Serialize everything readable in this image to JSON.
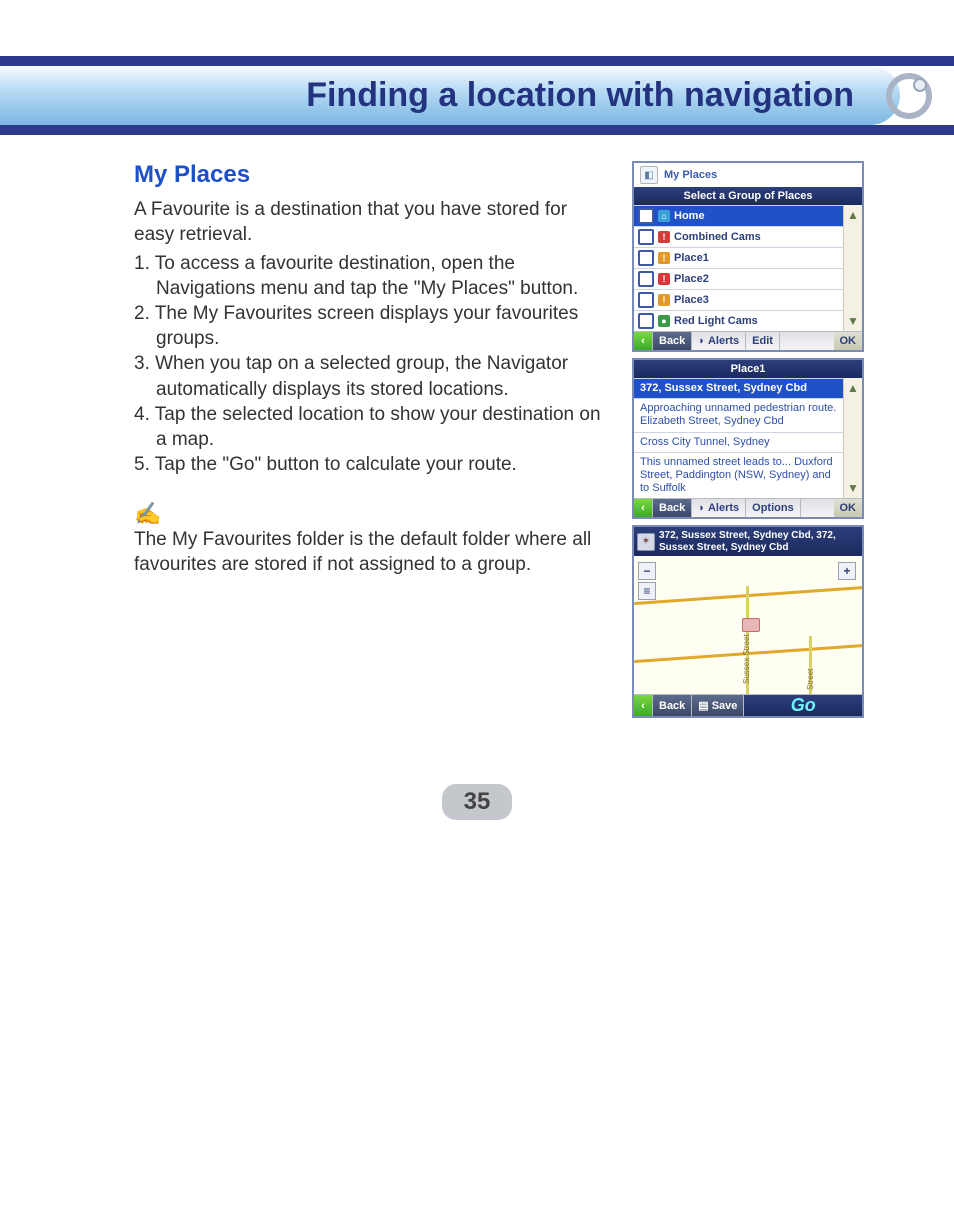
{
  "header": {
    "title": "Finding a location with navigation"
  },
  "section": {
    "heading": "My Places"
  },
  "intro": "A Favourite is a destination that you have stored for easy retrieval.",
  "steps": [
    "1. To access a favourite destination, open the Navigations menu and tap the \"My Places\" button.",
    "2. The My Favourites screen displays your favourites groups.",
    "3. When you tap on a selected group, the Navigator automatically displays its stored locations.",
    "4. Tap the selected location to show your destination on a map.",
    "5. Tap the \"Go\" button to calculate your route."
  ],
  "note": "The My Favourites folder is the default folder where all favourites are stored if not assigned to a group.",
  "shot1": {
    "title": "My Places",
    "bar": "Select a Group of Places",
    "items": [
      {
        "label": "Home",
        "icon": "home",
        "selected": true
      },
      {
        "label": "Combined Cams",
        "icon": "red"
      },
      {
        "label": "Place1",
        "icon": "orange"
      },
      {
        "label": "Place2",
        "icon": "red"
      },
      {
        "label": "Place3",
        "icon": "orange"
      },
      {
        "label": "Red Light Cams",
        "icon": "green"
      }
    ],
    "foot": {
      "back": "Back",
      "alerts": "Alerts",
      "edit": "Edit",
      "ok": "OK"
    }
  },
  "shot2": {
    "bar": "Place1",
    "rows": [
      "372, Sussex Street, Sydney Cbd",
      "Approaching unnamed pedestrian route. Elizabeth Street, Sydney Cbd",
      "Cross City Tunnel, Sydney",
      "This unnamed street leads to... Duxford Street, Paddington (NSW, Sydney) and to Suffolk"
    ],
    "foot": {
      "back": "Back",
      "alerts": "Alerts",
      "options": "Options",
      "ok": "OK"
    }
  },
  "shot3": {
    "head": "372, Sussex Street, Sydney Cbd, 372, Sussex Street, Sydney Cbd",
    "street1": "Sussex Street",
    "street2": "Street",
    "foot": {
      "back": "Back",
      "save": "Save",
      "go": "Go"
    }
  },
  "page_number": "35"
}
